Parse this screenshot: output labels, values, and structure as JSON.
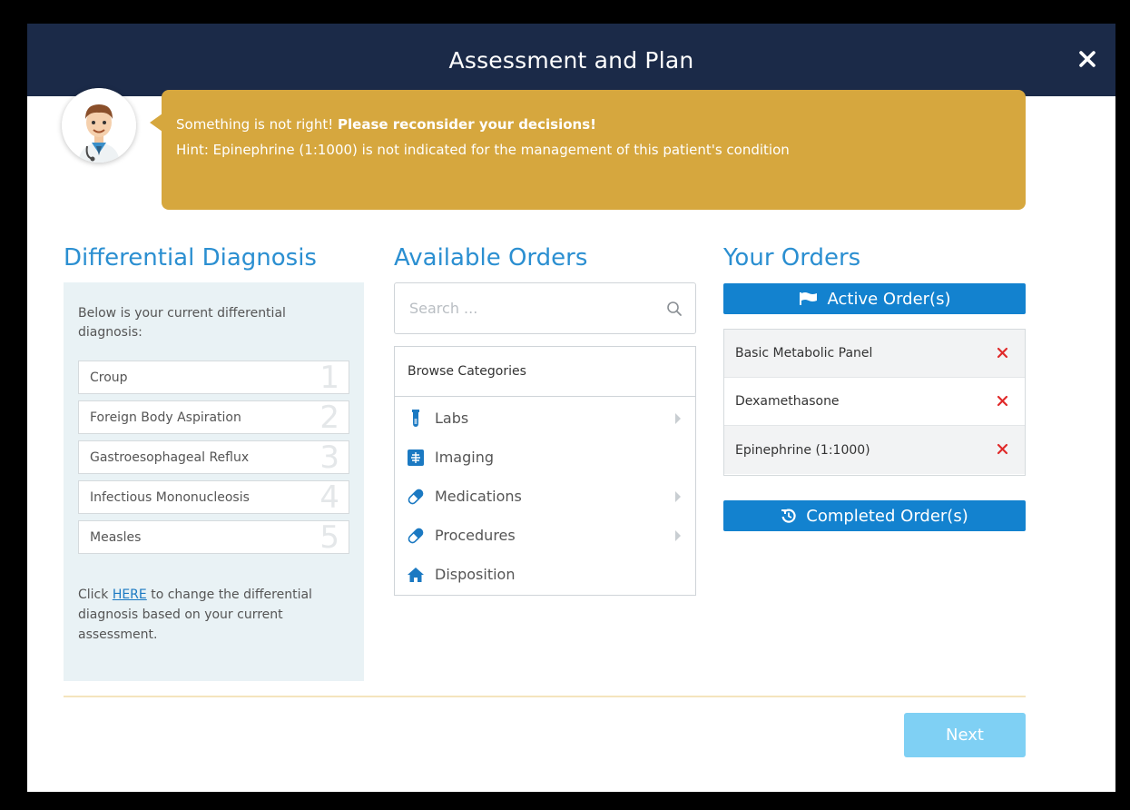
{
  "modal": {
    "title": "Assessment and Plan"
  },
  "hint": {
    "line1_normal": "Something is not right! ",
    "line1_bold": "Please reconsider your decisions!",
    "line2": "Hint: Epinephrine (1:1000) is not indicated for the management of this patient's condition"
  },
  "differential": {
    "title": "Differential Diagnosis",
    "intro": "Below is your current differential diagnosis:",
    "items": [
      {
        "label": "Croup",
        "num": "1"
      },
      {
        "label": "Foreign Body Aspiration",
        "num": "2"
      },
      {
        "label": "Gastroesophageal Reflux",
        "num": "3"
      },
      {
        "label": "Infectious Mononucleosis",
        "num": "4"
      },
      {
        "label": "Measles",
        "num": "5"
      }
    ],
    "footer_pre": "Click ",
    "footer_link": "HERE",
    "footer_post": " to change the differential diagnosis based on your current assessment."
  },
  "available": {
    "title": "Available Orders",
    "search_placeholder": "Search ...",
    "browse_header": "Browse Categories",
    "categories": [
      {
        "label": "Labs",
        "icon": "test-tube-icon"
      },
      {
        "label": "Imaging",
        "icon": "xray-icon"
      },
      {
        "label": "Medications",
        "icon": "pill-icon"
      },
      {
        "label": "Procedures",
        "icon": "pill-icon"
      },
      {
        "label": "Disposition",
        "icon": "home-icon"
      }
    ]
  },
  "your_orders": {
    "title": "Your Orders",
    "active_label": "Active Order(s)",
    "completed_label": "Completed Order(s)",
    "items": [
      "Basic Metabolic Panel",
      "Dexamethasone",
      "Epinephrine (1:1000)"
    ]
  },
  "footer": {
    "next_label": "Next"
  },
  "colors": {
    "header_bg": "#1b2a48",
    "hint_bg": "#d6a73e",
    "accent_blue": "#2b8fd1",
    "button_blue": "#1382cf",
    "remove_red": "#e02a2a",
    "next_disabled": "#7fd0f4"
  }
}
